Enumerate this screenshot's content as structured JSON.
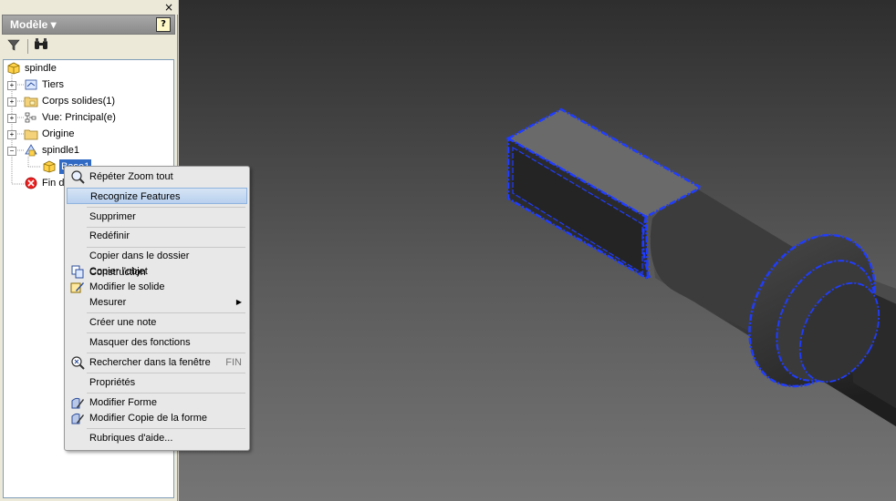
{
  "panel": {
    "close_glyph": "×",
    "title": "Modèle ▾",
    "help_glyph": "?",
    "toolbar": {
      "filter_icon": "filter-icon",
      "search_icon": "binoculars-icon"
    }
  },
  "tree": {
    "root": "spindle",
    "items": [
      {
        "label": "Tiers",
        "icon": "parameters-icon"
      },
      {
        "label": "Corps solides(1)",
        "icon": "solid-bodies-folder-icon"
      },
      {
        "label": "Vue: Principal(e)",
        "icon": "view-icon"
      },
      {
        "label": "Origine",
        "icon": "folder-icon"
      },
      {
        "label": "spindle1",
        "icon": "derived-part-icon"
      },
      {
        "label": "Base1",
        "icon": "base-feature-icon"
      },
      {
        "label": "Fin de",
        "icon": "end-of-part-icon"
      }
    ]
  },
  "menu": {
    "items": [
      {
        "label": "Répéter Zoom tout",
        "icon": "zoom-icon"
      },
      {
        "label": "Recognize Features"
      },
      {
        "label": "Supprimer"
      },
      {
        "label": "Redéfinir"
      },
      {
        "label": "Copier dans le dossier Construction"
      },
      {
        "label": "Copier l'objet",
        "icon": "copy-object-icon"
      },
      {
        "label": "Modifier le solide",
        "icon": "edit-solid-icon"
      },
      {
        "label": "Mesurer"
      },
      {
        "label": "Créer une note"
      },
      {
        "label": "Masquer des fonctions"
      },
      {
        "label": "Rechercher dans la fenêtre",
        "shortcut": "FIN",
        "icon": "find-icon"
      },
      {
        "label": "Propriétés"
      },
      {
        "label": "Modifier Forme",
        "icon": "edit-shape-icon"
      },
      {
        "label": "Modifier Copie de la forme",
        "icon": "edit-shape-copy-icon"
      },
      {
        "label": "Rubriques d'aide..."
      }
    ]
  },
  "colors": {
    "highlight_edges": "#1f3cff",
    "viewport_top": "#2e2e2e",
    "viewport_bottom": "#757575"
  }
}
